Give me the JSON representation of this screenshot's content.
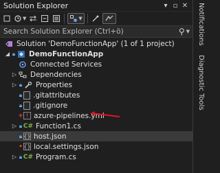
{
  "window": {
    "title": "Solution Explorer",
    "title_buttons": [
      "▾",
      "▫",
      "✕"
    ]
  },
  "toolbar": {
    "icons": [
      "nav-back-icon",
      "history-icon",
      "sync-icon",
      "collapse-icon",
      "pending-changes-icon",
      "filter-icon",
      "properties-icon",
      "preview-icon"
    ]
  },
  "search": {
    "placeholder": "Search Solution Explorer (Ctrl+ö)"
  },
  "tree": {
    "solution": "Solution 'DemoFunctionApp' (1 of 1 project)",
    "project": "DemoFunctionApp",
    "items": [
      {
        "label": "Connected Services",
        "icon": "connected-services-icon"
      },
      {
        "label": "Dependencies",
        "icon": "dependencies-icon"
      },
      {
        "label": "Properties",
        "icon": "wrench-icon"
      },
      {
        "label": ".gitattributes",
        "icon": "file-icon"
      },
      {
        "label": ".gitignore",
        "icon": "file-icon"
      },
      {
        "label": "azure-pipelines.yml",
        "icon": "yaml-icon"
      },
      {
        "label": "Function1.cs",
        "icon": "csharp-icon"
      },
      {
        "label": "host.json",
        "icon": "json-icon"
      },
      {
        "label": "local.settings.json",
        "icon": "json-icon"
      },
      {
        "label": "Program.cs",
        "icon": "csharp-icon"
      }
    ]
  },
  "side_tabs": {
    "notifications": "Notifications",
    "diagnostic_tools": "Diagnostic Tools"
  },
  "colors": {
    "background": "#1f1f1f",
    "selection": "#3a3a3a",
    "annotation_arrow": "#e81123"
  }
}
